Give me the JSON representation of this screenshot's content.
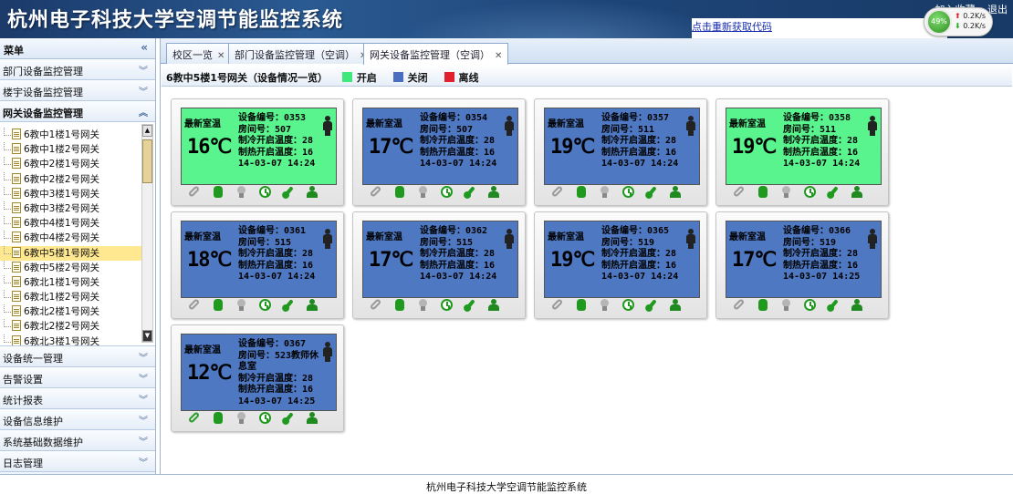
{
  "app": {
    "title": "杭州电子科技大学空调节能监控系统",
    "refresh_link": "点击重新获取代码",
    "header_links": [
      "加入收藏",
      "退出"
    ]
  },
  "network_widget": {
    "percent": "49%",
    "up_rate": "0.2K/s",
    "down_rate": "0.2K/s"
  },
  "sidebar": {
    "title": "菜单",
    "sections": [
      {
        "label": "部门设备监控管理"
      },
      {
        "label": "楼宇设备监控管理"
      },
      {
        "label": "网关设备监控管理"
      }
    ],
    "tree_items": [
      "6教中1楼1号网关",
      "6教中1楼2号网关",
      "6教中2楼1号网关",
      "6教中2楼2号网关",
      "6教中3楼1号网关",
      "6教中3楼2号网关",
      "6教中4楼1号网关",
      "6教中4楼2号网关",
      "6教中5楼1号网关",
      "6教中5楼2号网关",
      "6教北1楼1号网关",
      "6教北1楼2号网关",
      "6教北2楼1号网关",
      "6教北2楼2号网关",
      "6教北3楼1号网关"
    ],
    "selected_index": 8,
    "bottom_sections": [
      {
        "label": "设备统一管理"
      },
      {
        "label": "告警设置"
      },
      {
        "label": "统计报表"
      },
      {
        "label": "设备信息维护"
      },
      {
        "label": "系统基础数据维护"
      },
      {
        "label": "日志管理"
      }
    ]
  },
  "tabs": [
    {
      "label": "校区一览"
    },
    {
      "label": "部门设备监控管理（空调）"
    },
    {
      "label": "网关设备监控管理（空调）",
      "active": true
    }
  ],
  "legend": {
    "title": "6教中5楼1号网关（设备情况一览）",
    "items": [
      {
        "label": "开启",
        "color": "#3ee87a"
      },
      {
        "label": "关闭",
        "color": "#4a6fc0"
      },
      {
        "label": "离线",
        "color": "#e0202a"
      }
    ]
  },
  "card_labels": {
    "latest": "最新室温",
    "device_no": "设备编号：",
    "room_no": "房间号：",
    "cool_temp": "制冷开启温度：",
    "heat_temp": "制热开启温度："
  },
  "devices": [
    {
      "state": "on",
      "temp": "16℃",
      "device_no": "0353",
      "room": "507",
      "cool": "28",
      "heat": "16",
      "time": "14-03-07 14:24",
      "link_ok": false
    },
    {
      "state": "off",
      "temp": "17℃",
      "device_no": "0354",
      "room": "507",
      "cool": "28",
      "heat": "16",
      "time": "14-03-07 14:24",
      "link_ok": false
    },
    {
      "state": "off",
      "temp": "19℃",
      "device_no": "0357",
      "room": "511",
      "cool": "28",
      "heat": "16",
      "time": "14-03-07 14:24",
      "link_ok": false
    },
    {
      "state": "on",
      "temp": "19℃",
      "device_no": "0358",
      "room": "511",
      "cool": "28",
      "heat": "16",
      "time": "14-03-07 14:24",
      "link_ok": false
    },
    {
      "state": "off",
      "temp": "18℃",
      "device_no": "0361",
      "room": "515",
      "cool": "28",
      "heat": "16",
      "time": "14-03-07 14:24",
      "link_ok": false
    },
    {
      "state": "off",
      "temp": "17℃",
      "device_no": "0362",
      "room": "515",
      "cool": "28",
      "heat": "16",
      "time": "14-03-07 14:24",
      "link_ok": false
    },
    {
      "state": "off",
      "temp": "19℃",
      "device_no": "0365",
      "room": "519",
      "cool": "28",
      "heat": "16",
      "time": "14-03-07 14:24",
      "link_ok": false
    },
    {
      "state": "off",
      "temp": "17℃",
      "device_no": "0366",
      "room": "519",
      "cool": "28",
      "heat": "16",
      "time": "14-03-07 14:25",
      "link_ok": false
    },
    {
      "state": "off",
      "temp": "12℃",
      "device_no": "0367",
      "room": "523教师休息室",
      "cool": "28",
      "heat": "16",
      "time": "14-03-07 14:25",
      "link_ok": true
    }
  ],
  "footer": {
    "text": "杭州电子科技大学空调节能监控系统"
  }
}
